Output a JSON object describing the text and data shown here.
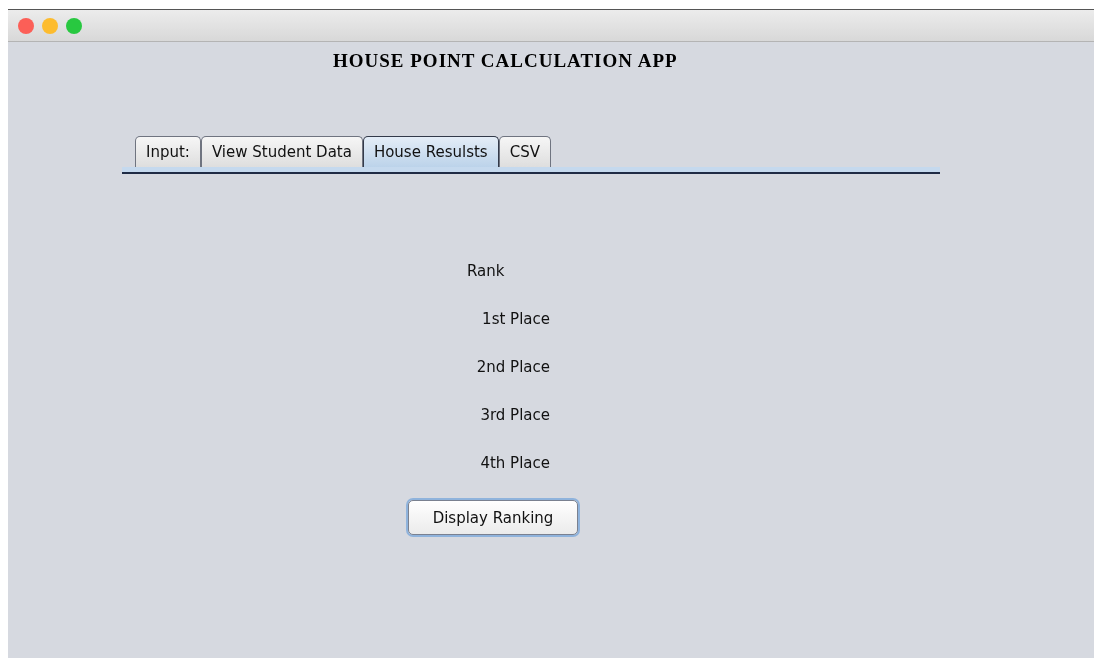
{
  "window": {
    "title": "HOUSE POINT CALCULATION APP"
  },
  "tabs": [
    {
      "label": "Input:",
      "selected": false
    },
    {
      "label": "View Student Data",
      "selected": false
    },
    {
      "label": "House Resulsts",
      "selected": true
    },
    {
      "label": "CSV",
      "selected": false
    }
  ],
  "results": {
    "heading": "Rank",
    "places": [
      "1st Place",
      "2nd Place",
      "3rd Place",
      "4th Place"
    ]
  },
  "buttons": [
    "Display Ranking"
  ]
}
